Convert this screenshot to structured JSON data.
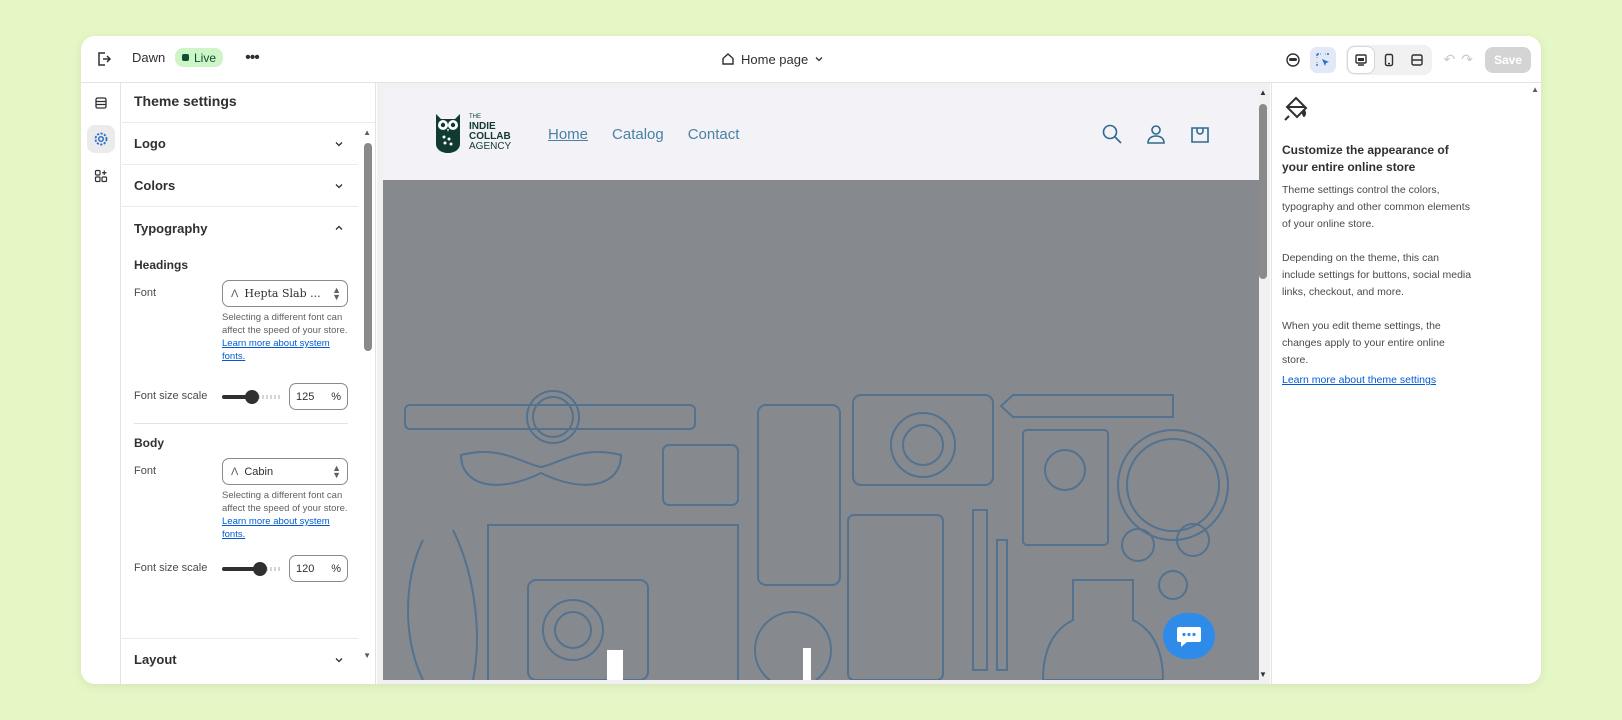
{
  "topbar": {
    "theme_name": "Dawn",
    "live_badge": "Live",
    "more": "•••",
    "page_selector": "Home page",
    "save_label": "Save"
  },
  "rail": {
    "items": [
      "sections",
      "theme-settings",
      "apps"
    ]
  },
  "settings": {
    "title": "Theme settings",
    "sections": {
      "logo": "Logo",
      "colors": "Colors",
      "typography": "Typography",
      "layout": "Layout"
    },
    "headings": {
      "label": "Headings",
      "font_label": "Font",
      "font_value": "Hepta Slab ...",
      "help": "Selecting a different font can affect the speed of your store.",
      "help_link": "Learn more about system fonts.",
      "size_label": "Font size scale",
      "size_value": "125",
      "size_unit": "%",
      "size_fraction": 0.5
    },
    "body": {
      "label": "Body",
      "font_label": "Font",
      "font_value": "Cabin",
      "help": "Selecting a different font can affect the speed of your store.",
      "help_link": "Learn more about system fonts.",
      "size_label": "Font size scale",
      "size_value": "120",
      "size_unit": "%",
      "size_fraction": 0.63
    }
  },
  "preview": {
    "logo": {
      "line1": "THE",
      "line2": "INDIE",
      "line3": "COLLAB",
      "line4": "AGENCY"
    },
    "nav": [
      "Home",
      "Catalog",
      "Contact"
    ]
  },
  "info": {
    "heading": "Customize the appearance of your entire online store",
    "p1": "Theme settings control the colors, typography and other common elements of your online store.",
    "p2": "Depending on the theme, this can include settings for buttons, social media links, checkout, and more.",
    "p3": "When you edit theme settings, the changes apply to your entire online store.",
    "link": "Learn more about theme settings"
  },
  "colors": {
    "accent_link": "#005bd3",
    "live_badge_bg": "#cdf5c8",
    "hero_overlay": "#868a8f",
    "nav_link": "#4a81a8",
    "chat_button": "#2f8bea"
  }
}
